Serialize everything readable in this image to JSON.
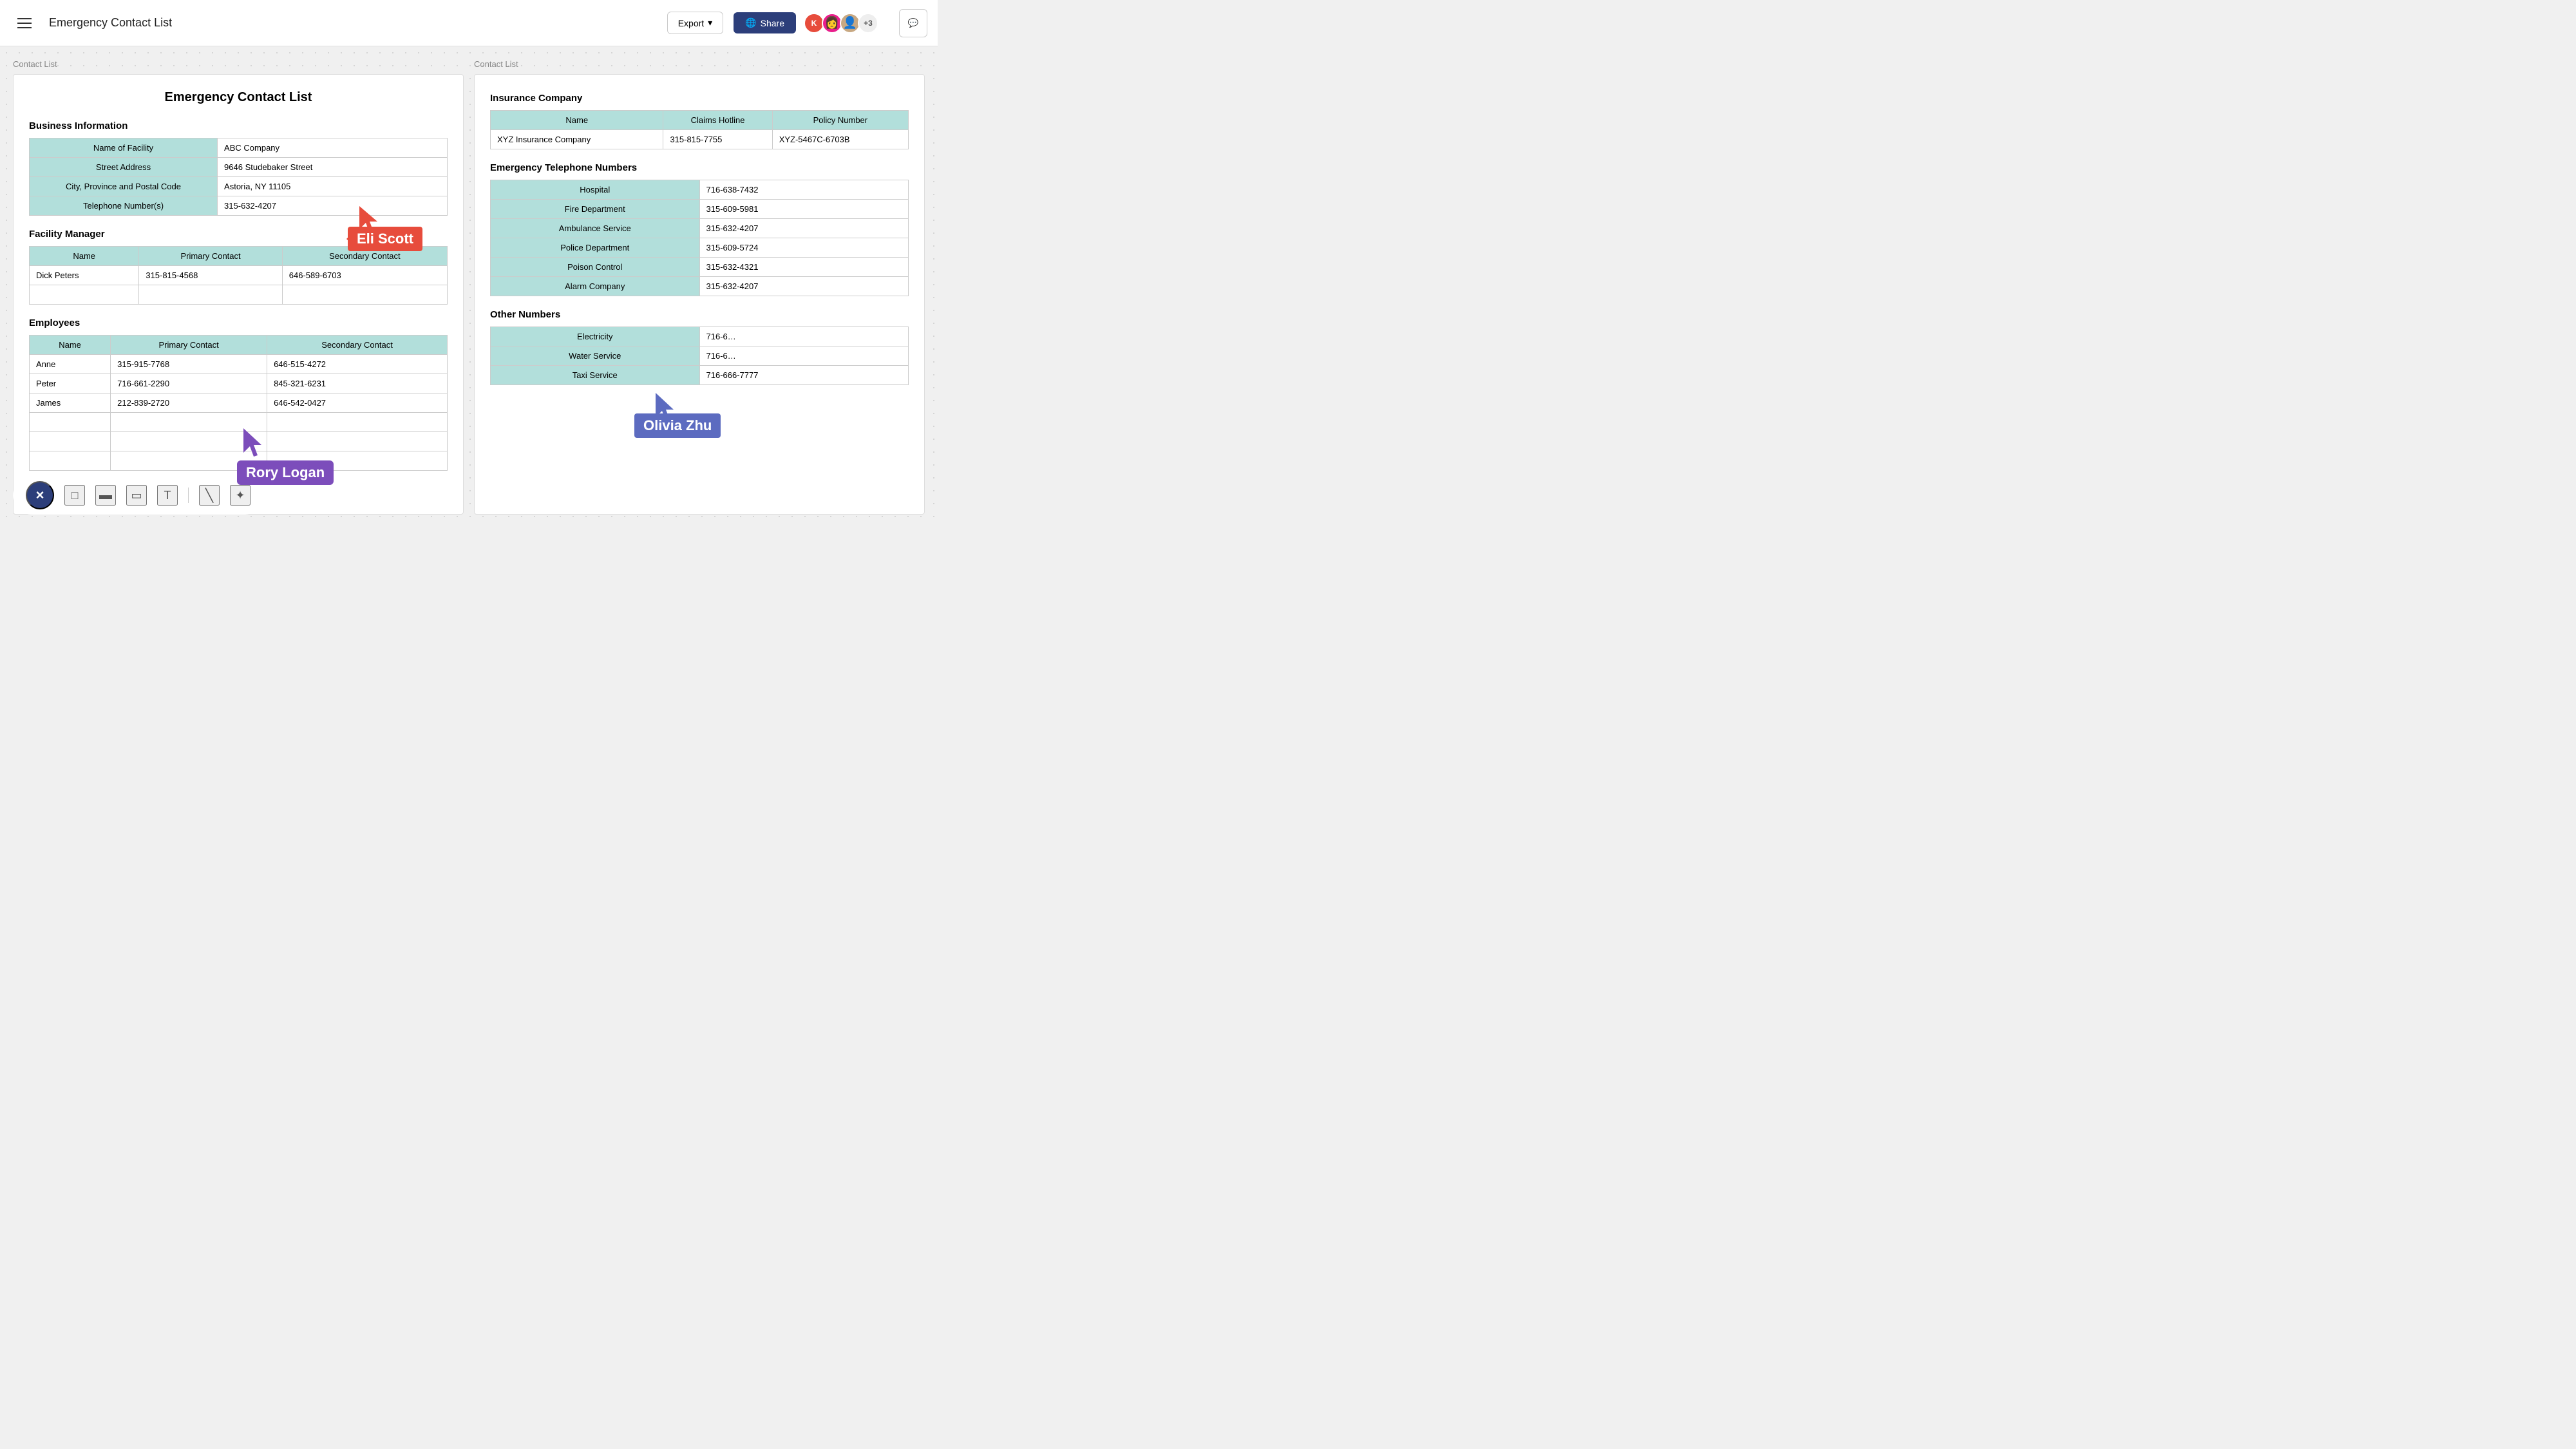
{
  "header": {
    "menu_icon": "hamburger",
    "title": "Emergency Contact List",
    "export_label": "Export",
    "share_label": "Share",
    "avatar_count": "+3",
    "chat_icon": "chat"
  },
  "panels": {
    "left_label": "Contact List",
    "right_label": "Contact List"
  },
  "document": {
    "title": "Emergency Contact List",
    "business_section": "Business Information",
    "business_rows": [
      {
        "label": "Name of Facility",
        "value": "ABC Company"
      },
      {
        "label": "Street Address",
        "value": "9646 Studebaker Street"
      },
      {
        "label": "City, Province and Postal Code",
        "value": "Astoria, NY 11105"
      },
      {
        "label": "Telephone Number(s)",
        "value": "315-632-4207"
      }
    ],
    "facility_section": "Facility Manager",
    "facility_cols": [
      "Name",
      "Primary Contact",
      "Secondary Contact"
    ],
    "facility_rows": [
      {
        "name": "Dick Peters",
        "primary": "315-815-4568",
        "secondary": "646-589-6703"
      },
      {
        "name": "",
        "primary": "",
        "secondary": ""
      }
    ],
    "employees_section": "Employees",
    "employees_cols": [
      "Name",
      "Primary Contact",
      "Secondary Contact"
    ],
    "employees_rows": [
      {
        "name": "Anne",
        "primary": "315-915-7768",
        "secondary": "646-515-4272"
      },
      {
        "name": "Peter",
        "primary": "716-661-2290",
        "secondary": "845-321-6231"
      },
      {
        "name": "James",
        "primary": "212-839-2720",
        "secondary": "646-542-0427"
      },
      {
        "name": "",
        "primary": "",
        "secondary": ""
      },
      {
        "name": "",
        "primary": "",
        "secondary": ""
      },
      {
        "name": "",
        "primary": "",
        "secondary": ""
      }
    ]
  },
  "right_panel": {
    "insurance_section": "Insurance Company",
    "insurance_cols": [
      "Name",
      "Claims Hotline",
      "Policy Number"
    ],
    "insurance_rows": [
      {
        "name": "XYZ Insurance Company",
        "hotline": "315-815-7755",
        "policy": "XYZ-5467C-6703B"
      }
    ],
    "emergency_section": "Emergency Telephone Numbers",
    "emergency_rows": [
      {
        "label": "Hospital",
        "number": "716-638-7432"
      },
      {
        "label": "Fire Department",
        "number": "315-609-5981"
      },
      {
        "label": "Ambulance Service",
        "number": "315-632-4207"
      },
      {
        "label": "Police Department",
        "number": "315-609-5724"
      },
      {
        "label": "Poison Control",
        "number": "315-632-4321"
      },
      {
        "label": "Alarm Company",
        "number": "315-632-4207"
      }
    ],
    "other_section": "Other Numbers",
    "other_rows": [
      {
        "label": "Electricity",
        "number": "716-6…"
      },
      {
        "label": "Water Service",
        "number": "716-6…"
      },
      {
        "label": "Taxi Service",
        "number": "716-666-7777"
      }
    ]
  },
  "annotations": {
    "eli_scott": "Eli Scott",
    "rory_logan": "Rory Logan",
    "olivia_zhu": "Olivia Zhu"
  },
  "toolbar": {
    "close_icon": "×",
    "rect_icon": "□",
    "card_icon": "▬",
    "note_icon": "▭",
    "text_icon": "T",
    "line_icon": "╲",
    "pointer_icon": "✦"
  }
}
